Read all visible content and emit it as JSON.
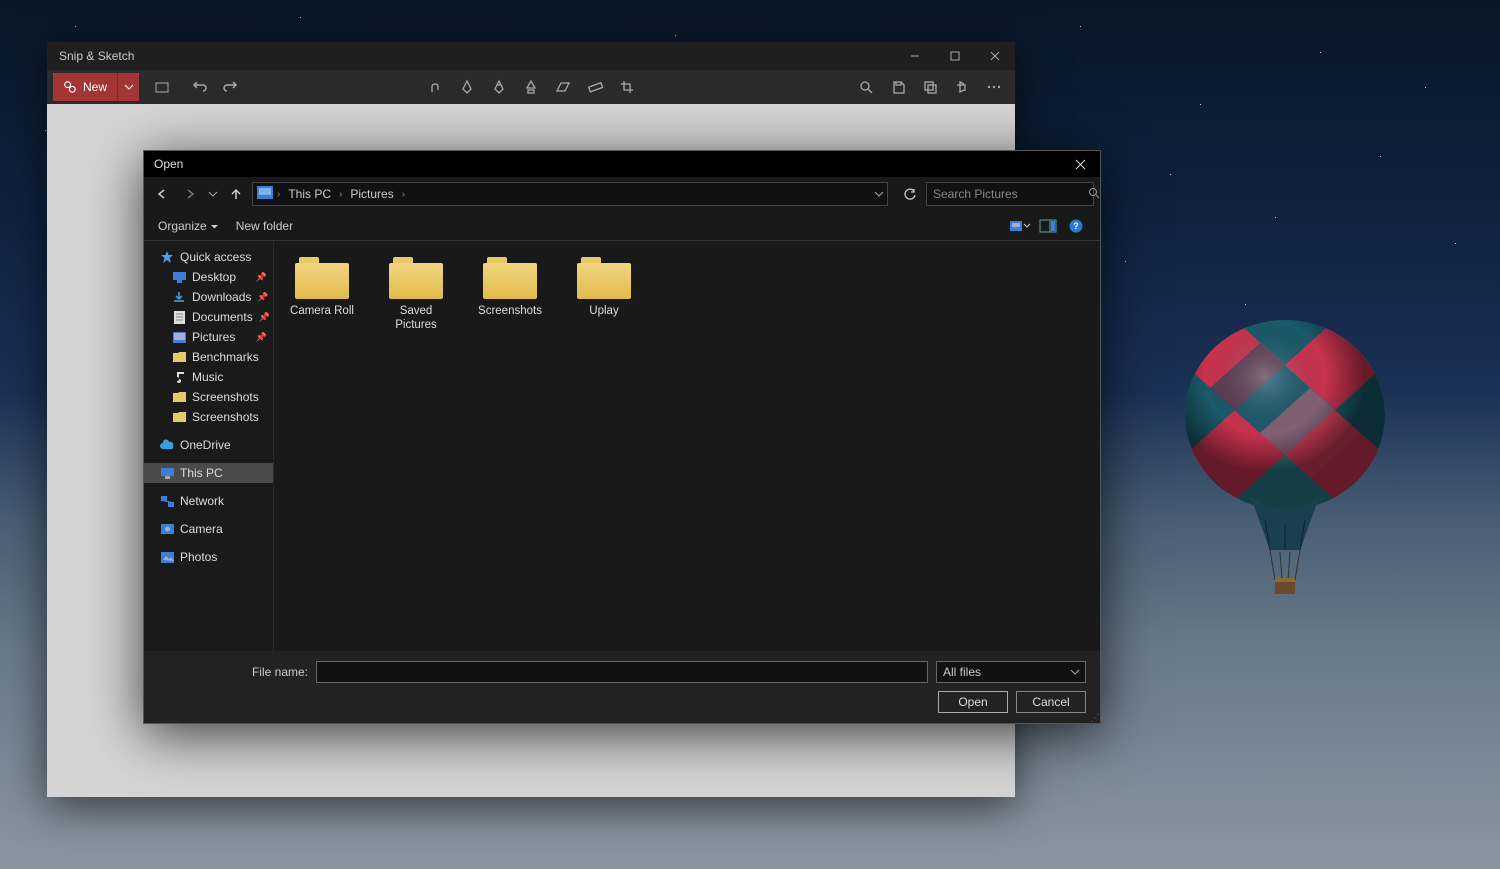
{
  "snip": {
    "title": "Snip & Sketch",
    "new_label": "New"
  },
  "dialog": {
    "title": "Open",
    "breadcrumb": [
      "This PC",
      "Pictures"
    ],
    "search_placeholder": "Search Pictures",
    "organize": "Organize",
    "new_folder": "New folder",
    "tree": {
      "quick_access": "Quick access",
      "desktop": "Desktop",
      "downloads": "Downloads",
      "documents": "Documents",
      "pictures": "Pictures",
      "benchmarks": "Benchmarks",
      "music": "Music",
      "screenshots1": "Screenshots",
      "screenshots2": "Screenshots",
      "onedrive": "OneDrive",
      "this_pc": "This PC",
      "network": "Network",
      "camera": "Camera",
      "photos": "Photos"
    },
    "folders": [
      {
        "name": "Camera Roll"
      },
      {
        "name": "Saved Pictures"
      },
      {
        "name": "Screenshots"
      },
      {
        "name": "Uplay"
      }
    ],
    "file_name_label": "File name:",
    "file_name_value": "",
    "filter": "All files",
    "open_btn": "Open",
    "cancel_btn": "Cancel"
  }
}
